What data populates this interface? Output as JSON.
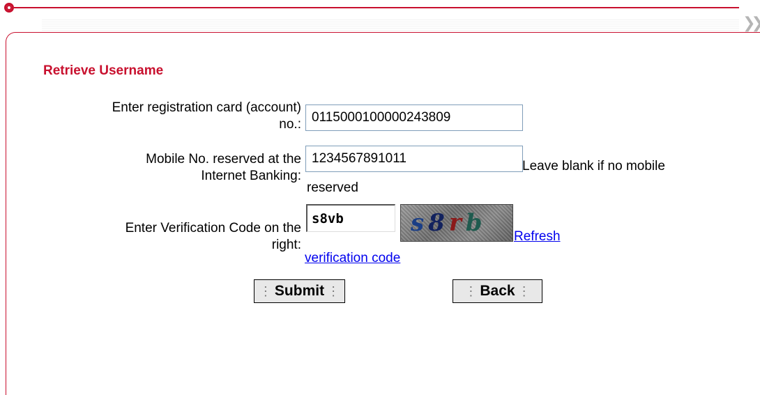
{
  "page": {
    "title": "Retrieve Username"
  },
  "form": {
    "account": {
      "label_line1": "Enter registration card (account)",
      "label_line2": "no.:",
      "value": "0115000100000243809"
    },
    "mobile": {
      "label_line1": "Mobile No. reserved at the",
      "label_line2": "Internet Banking:",
      "value": "1234567891011",
      "help_line1": "Leave blank if no mobile",
      "help_line2": "reserved"
    },
    "verification": {
      "label_line1": "Enter Verification Code on the",
      "label_line2": "right:",
      "value": "s8vb",
      "captcha_chars": [
        "s",
        "8",
        "r",
        "b"
      ],
      "refresh_link": "Refresh",
      "code_link": "verification code"
    }
  },
  "buttons": {
    "submit": "Submit",
    "back": "Back"
  },
  "colors": {
    "accent": "#c8102e",
    "link": "#0000ee",
    "input_border": "#7f9db9"
  }
}
